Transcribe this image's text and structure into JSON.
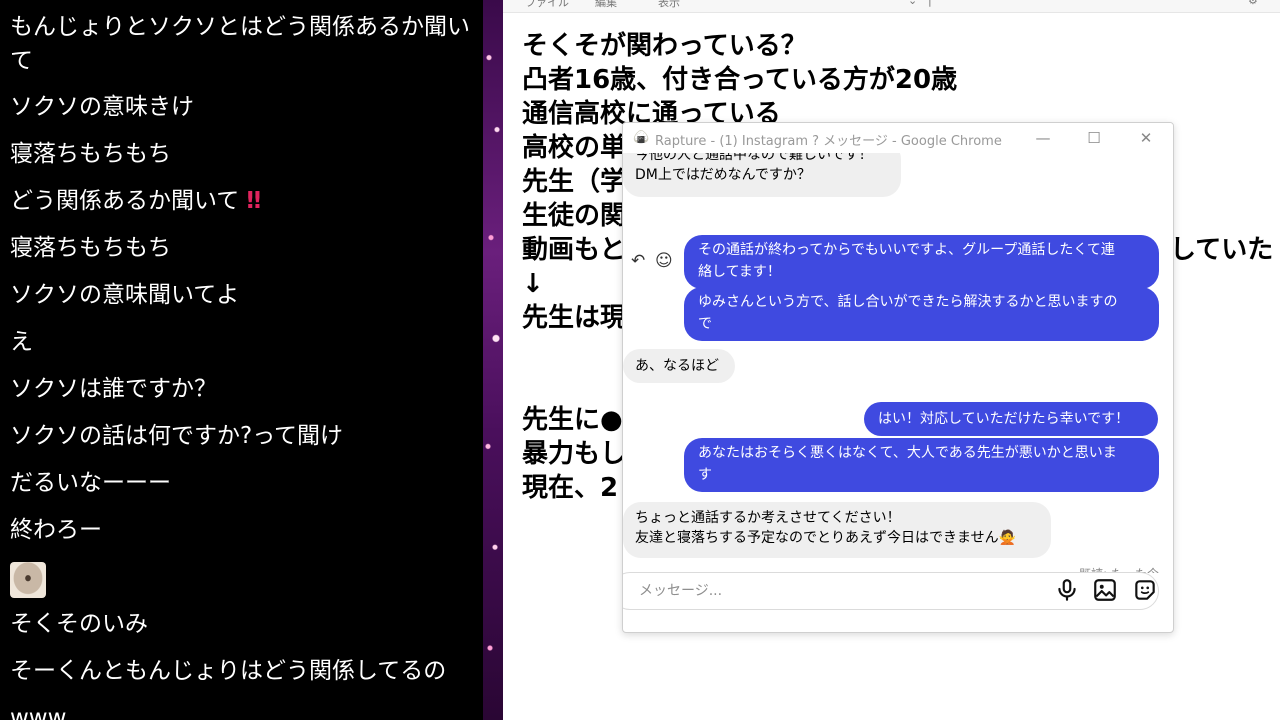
{
  "chat": {
    "lines": [
      "もんじょりとソクソとはどう関係あるか聞いて",
      "ソクソの意味きけ",
      "寝落ちもちもち",
      "どう関係あるか聞いて",
      "寝落ちもちもち",
      "ソクソの意味聞いてよ",
      "え",
      "ソクソは誰ですか？",
      "ソクソの話は何ですか?って聞け",
      "だるいなーーー",
      "終わろー",
      "そくそのいみ",
      "そーくんともんじょりはどう関係してるの",
      "www"
    ],
    "bang": "‼"
  },
  "notepad": {
    "menu": [
      "ファイル",
      "編集",
      "表示"
    ],
    "lines": [
      "そくそが関わっている？",
      "凸者16歳、付き合っている方が20歳",
      "通信高校に通っている",
      "高校の単",
      "先生（学",
      "生徒の関",
      "動画もと",
      "していた",
      "↓",
      "先生は現",
      "先生に●",
      "暴力もし",
      "現在、2"
    ]
  },
  "chrome": {
    "title": "Rapture - (1) Instagram ? メッセージ - Google Chrome",
    "app_icon": "onigiri-icon",
    "buttons": {
      "minimize": "—",
      "maximize": "☐",
      "close": "✕"
    },
    "messages": [
      {
        "from": "them",
        "lines": [
          "今他の人と通話中なので難しいです！",
          "DM上ではだめなんですか？"
        ]
      },
      {
        "from": "me",
        "lines": [
          "その通話が終わってからでもいいですよ、グループ通話したくて連",
          "絡してます！"
        ]
      },
      {
        "from": "me",
        "lines": [
          "ゆみさんという方で、話し合いができたら解決するかと思いますの",
          "で"
        ]
      },
      {
        "from": "them",
        "lines": [
          "あ、なるほど"
        ]
      },
      {
        "from": "me",
        "lines": [
          "はい！対応していただけたら幸いです！"
        ]
      },
      {
        "from": "me",
        "lines": [
          "あなたはおそらく悪くはなくて、大人である先生が悪いかと思いま",
          "す"
        ]
      },
      {
        "from": "them",
        "lines": [
          "ちょっと通話するか考えさせてください！",
          "友達と寝落ちする予定なのでとりあえず今日はできません🙅"
        ]
      }
    ],
    "reply_icon": "reply-icon",
    "react_icon": "smiley-icon",
    "seen": "既読: たった今",
    "composer": {
      "placeholder": "メッセージ...",
      "icons": [
        "microphone-icon",
        "image-icon",
        "sticker-icon"
      ]
    }
  },
  "colors": {
    "outgoing_bubble": "#3f4ae0",
    "incoming_bubble": "#efefef",
    "chat_text": "#ffffff",
    "chat_bg": "#000000"
  }
}
